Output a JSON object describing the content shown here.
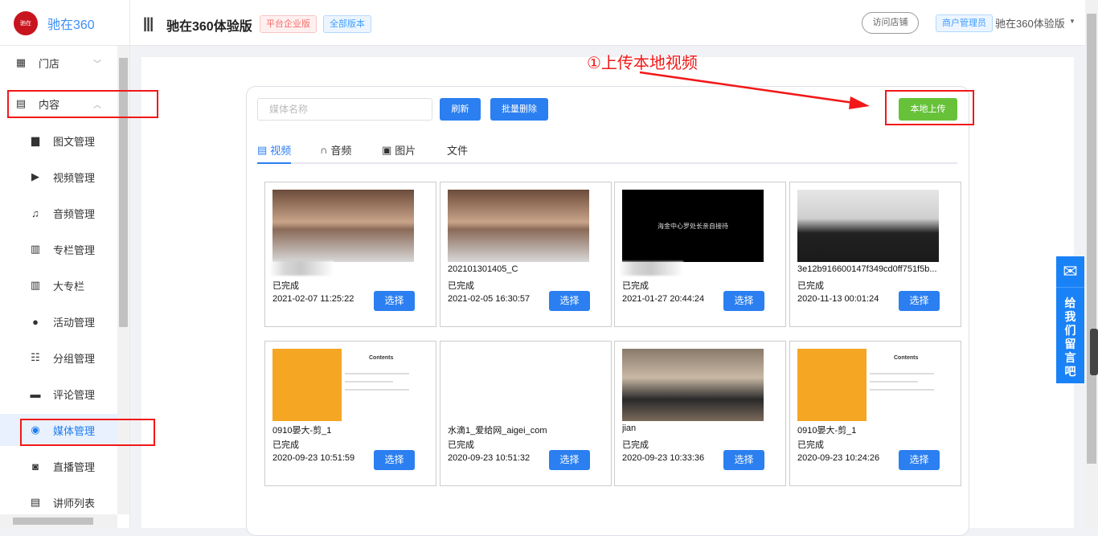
{
  "header": {
    "logo_text": "驰在360",
    "logo_mark": "驰在",
    "app_title": "驰在360体验版",
    "tag_platform": "平台企业版",
    "tag_version": "全部版本",
    "visit_store": "访问店铺",
    "role": "商户管理员",
    "user_name": "驰在360体验版",
    "menu_icon": "|||"
  },
  "sidebar": {
    "items": [
      {
        "label": "门店",
        "icon": "store-icon"
      },
      {
        "label": "内容",
        "icon": "content-icon"
      },
      {
        "label": "图文管理"
      },
      {
        "label": "视频管理"
      },
      {
        "label": "音频管理"
      },
      {
        "label": "专栏管理"
      },
      {
        "label": "大专栏"
      },
      {
        "label": "活动管理"
      },
      {
        "label": "分组管理"
      },
      {
        "label": "评论管理"
      },
      {
        "label": "媒体管理"
      },
      {
        "label": "直播管理"
      },
      {
        "label": "讲师列表"
      }
    ]
  },
  "toolbar": {
    "search_placeholder": "媒体名称",
    "refresh": "刷新",
    "batch_delete": "批量删除",
    "upload": "本地上传"
  },
  "tabs": [
    "视频",
    "音频",
    "图片",
    "文件"
  ],
  "annotation": "①上传本地视频",
  "select_label": "选择",
  "cards": [
    {
      "name": "",
      "status": "已完成",
      "time": "2021-02-07 11:25:22"
    },
    {
      "name": "202101301405_C",
      "status": "已完成",
      "time": "2021-02-05 16:30:57"
    },
    {
      "name": "",
      "status": "已完成",
      "time": "2021-01-27 20:44:24",
      "caption": "海金中心罗处长亲自接待"
    },
    {
      "name": "3e12b916600147f349cd0ff751f5b...",
      "status": "已完成",
      "time": "2020-11-13 00:01:24"
    },
    {
      "name": "0910晏大-剪_1",
      "status": "已完成",
      "time": "2020-09-23 10:51:59",
      "slide_title": "Contents"
    },
    {
      "name": "水滴1_爱给网_aigei_com",
      "status": "已完成",
      "time": "2020-09-23 10:51:32"
    },
    {
      "name": "jian",
      "status": "已完成",
      "time": "2020-09-23 10:33:36"
    },
    {
      "name": "0910晏大-剪_1",
      "status": "已完成",
      "time": "2020-09-23 10:24:26",
      "slide_title": "Contents"
    }
  ],
  "feedback": "给我们留言吧"
}
